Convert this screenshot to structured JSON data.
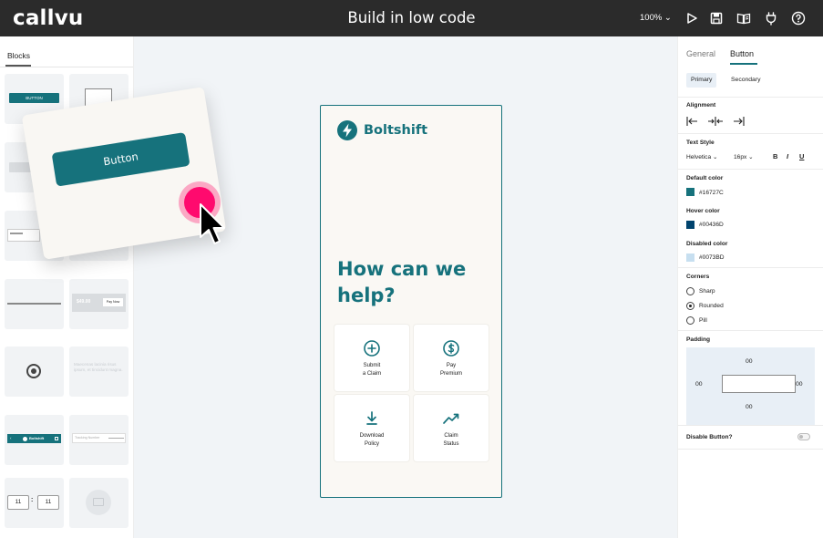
{
  "header": {
    "logo": "callvu",
    "title": "Build in low code",
    "zoom": "100% ⌄",
    "icons": [
      "play-icon",
      "save-icon",
      "book-icon",
      "plug-icon",
      "help-icon"
    ]
  },
  "left_panel": {
    "tab": "Blocks",
    "tiles": {
      "button_mini": "BUTTON",
      "pay_amount": "$49.00",
      "pay_button": "Pay Now",
      "faded_text": "Maecenas lacinia risus ipsum, et tincidunt magna.",
      "brand_mini": "Boltshift",
      "field_mini": "Tracking Number",
      "time_hours": "11",
      "time_minutes": "11",
      "time_separator": ":"
    },
    "dragged_block_label": "Button"
  },
  "phone": {
    "brand": "Boltshift",
    "headline": "How can we help?",
    "cards": [
      {
        "line1": "Submit",
        "line2": "a Claim",
        "icon": "plus-circle-icon"
      },
      {
        "line1": "Pay",
        "line2": "Premium",
        "icon": "dollar-circle-icon"
      },
      {
        "line1": "Download",
        "line2": "Policy",
        "icon": "download-icon"
      },
      {
        "line1": "Claim",
        "line2": "Status",
        "icon": "trend-icon"
      }
    ]
  },
  "right_panel": {
    "tabs": {
      "general": "General",
      "button": "Button"
    },
    "variants": {
      "primary": "Primary",
      "secondary": "Secondary"
    },
    "alignment_label": "Alignment",
    "text_style_label": "Text Style",
    "font": "Helvetica ⌄",
    "size": "16px ⌄",
    "bold": "B",
    "italic": "I",
    "underline": "U",
    "default_color_label": "Default color",
    "default_color": "#16727C",
    "hover_color_label": "Hover color",
    "hover_color": "#00436D",
    "disabled_color_label": "Disabled color",
    "disabled_color": "#0073BD",
    "disabled_swatch": "#c7dff0",
    "corners_label": "Corners",
    "corners": [
      "Sharp",
      "Rounded",
      "Pill"
    ],
    "corner_selected": "Rounded",
    "padding_label": "Padding",
    "padding": {
      "top": "00",
      "left": "00",
      "right": "00",
      "bottom": "00"
    },
    "disable_button_label": "Disable Button?"
  },
  "colors": {
    "accent": "#16727c",
    "topbar": "#2b2b2b",
    "cursor_highlight": "#ff0a6e"
  }
}
